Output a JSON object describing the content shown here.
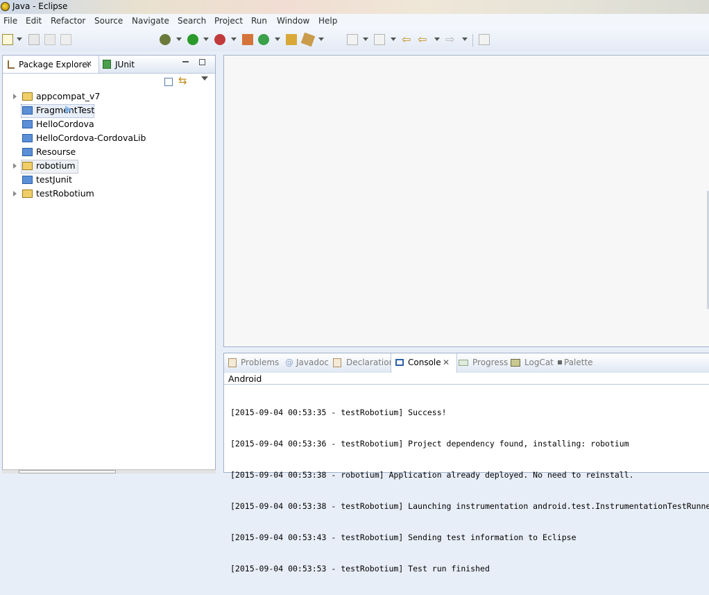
{
  "window": {
    "title": "Java - Eclipse"
  },
  "menu": [
    "File",
    "Edit",
    "Refactor",
    "Source",
    "Navigate",
    "Search",
    "Project",
    "Run",
    "Window",
    "Help"
  ],
  "left_panel": {
    "tabs": [
      {
        "label": "Package Explorer",
        "active": true
      },
      {
        "label": "JUnit",
        "active": false
      }
    ],
    "projects": [
      {
        "label": "appcompat_v7",
        "expandable": true
      },
      {
        "label": "FragmentTest",
        "expandable": false,
        "selected": true
      },
      {
        "label": "HelloCordova",
        "expandable": false
      },
      {
        "label": "HelloCordova-CordovaLib",
        "expandable": false
      },
      {
        "label": "Resourse",
        "expandable": false
      },
      {
        "label": "robotium",
        "expandable": true,
        "highlighted": true
      },
      {
        "label": "testJunit",
        "expandable": false
      },
      {
        "label": "testRobotium",
        "expandable": true
      }
    ]
  },
  "bottom_panel": {
    "tabs": [
      {
        "label": "Problems",
        "active": false
      },
      {
        "label": "Javadoc",
        "active": false
      },
      {
        "label": "Declaration",
        "active": false
      },
      {
        "label": "Console",
        "active": true
      },
      {
        "label": "Progress",
        "active": false
      },
      {
        "label": "LogCat",
        "active": false
      },
      {
        "label": "Palette",
        "active": false
      }
    ],
    "console_name": "Android",
    "console_lines": [
      "[2015-09-04 00:53:35 - testRobotium] Success!",
      "[2015-09-04 00:53:36 - testRobotium] Project dependency found, installing: robotium",
      "[2015-09-04 00:53:38 - robotium] Application already deployed. No need to reinstall.",
      "[2015-09-04 00:53:38 - testRobotium] Launching instrumentation android.test.InstrumentationTestRunner",
      "[2015-09-04 00:53:43 - testRobotium] Sending test information to Eclipse",
      "[2015-09-04 00:53:53 - testRobotium] Test run finished"
    ]
  },
  "colors": {
    "accent": "#9fb1c9",
    "folder": "#5b8fd6",
    "run_green": "#2a9a2a"
  }
}
